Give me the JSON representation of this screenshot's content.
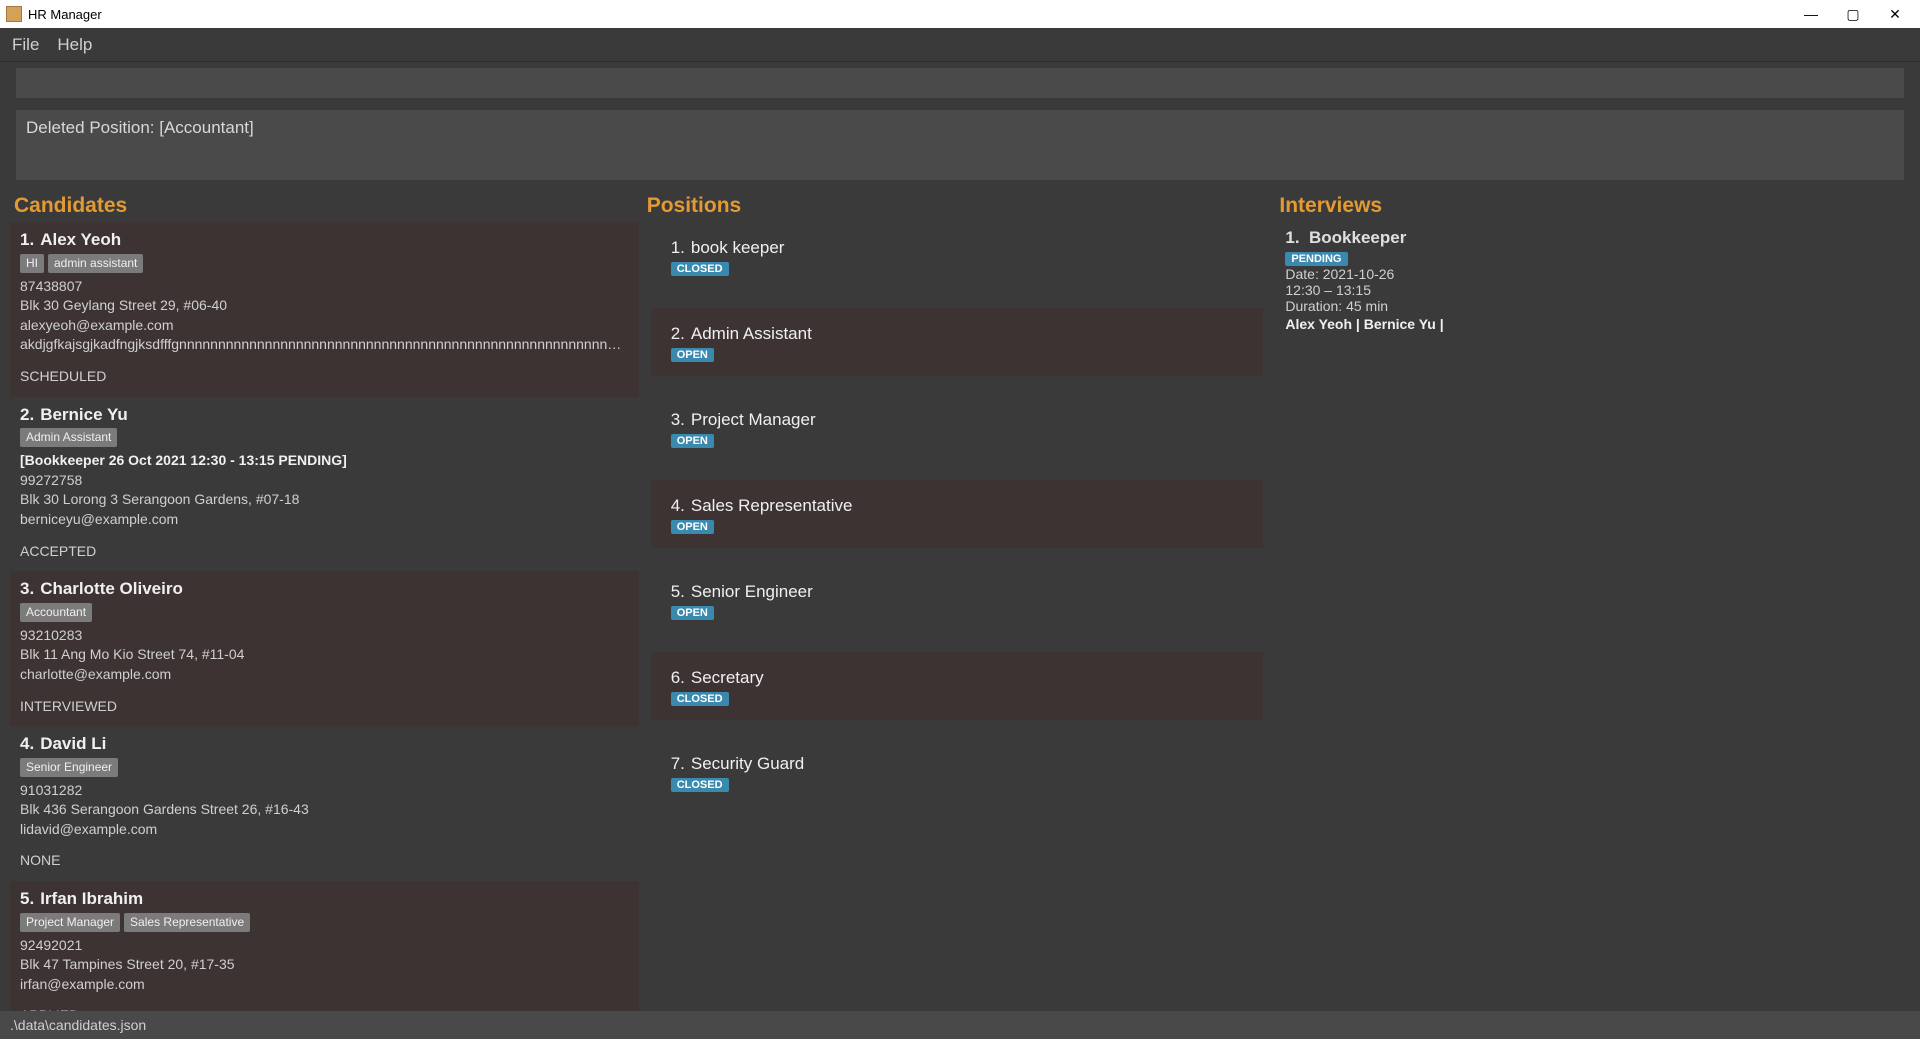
{
  "window": {
    "title": "HR Manager"
  },
  "menu": {
    "file": "File",
    "help": "Help"
  },
  "result_message": "Deleted Position: [Accountant]",
  "columns": {
    "candidates_title": "Candidates",
    "positions_title": "Positions",
    "interviews_title": "Interviews"
  },
  "candidates": [
    {
      "index": "1.",
      "name": "Alex Yeoh",
      "tags": [
        "HI",
        "admin assistant"
      ],
      "phone": "87438807",
      "address": "Blk 30 Geylang Street 29, #06-40",
      "email": "alexyeoh@example.com",
      "notes": "akdjgfkajsgjkadfngjksdfffgnnnnnnnnnnnnnnnnnnnnnnnnnnnnnnnnnnnnnnnnnnnnnnnnnnnnnnnnn...",
      "status": "SCHEDULED",
      "extra": ""
    },
    {
      "index": "2.",
      "name": "Bernice Yu",
      "tags": [
        "Admin Assistant"
      ],
      "extra": "[Bookkeeper 26 Oct 2021 12:30 - 13:15 PENDING]",
      "phone": "99272758",
      "address": "Blk 30 Lorong 3 Serangoon Gardens, #07-18",
      "email": "berniceyu@example.com",
      "notes": "",
      "status": "ACCEPTED"
    },
    {
      "index": "3.",
      "name": "Charlotte Oliveiro",
      "tags": [
        "Accountant"
      ],
      "extra": "",
      "phone": "93210283",
      "address": "Blk 11 Ang Mo Kio Street 74, #11-04",
      "email": "charlotte@example.com",
      "notes": "",
      "status": "INTERVIEWED"
    },
    {
      "index": "4.",
      "name": "David Li",
      "tags": [
        "Senior Engineer"
      ],
      "extra": "",
      "phone": "91031282",
      "address": "Blk 436 Serangoon Gardens Street 26, #16-43",
      "email": "lidavid@example.com",
      "notes": "",
      "status": "NONE"
    },
    {
      "index": "5.",
      "name": "Irfan Ibrahim",
      "tags": [
        "Project Manager",
        "Sales Representative"
      ],
      "extra": "",
      "phone": "92492021",
      "address": "Blk 47 Tampines Street 20, #17-35",
      "email": "irfan@example.com",
      "notes": "",
      "status": "APPLIED"
    }
  ],
  "positions": [
    {
      "index": "1.",
      "title": "book keeper",
      "status": "CLOSED"
    },
    {
      "index": "2.",
      "title": "Admin Assistant",
      "status": "OPEN"
    },
    {
      "index": "3.",
      "title": "Project Manager",
      "status": "OPEN"
    },
    {
      "index": "4.",
      "title": "Sales Representative",
      "status": "OPEN"
    },
    {
      "index": "5.",
      "title": "Senior Engineer",
      "status": "OPEN"
    },
    {
      "index": "6.",
      "title": "Secretary",
      "status": "CLOSED"
    },
    {
      "index": "7.",
      "title": "Security Guard",
      "status": "CLOSED"
    }
  ],
  "interviews": [
    {
      "index": "1.",
      "title": "Bookkeeper",
      "status": "PENDING",
      "date": "Date: 2021-10-26",
      "time": "12:30 – 13:15",
      "duration": "Duration: 45 min",
      "attendees": "Alex Yeoh | Bernice Yu |"
    }
  ],
  "statusbar": ".\\data\\candidates.json"
}
